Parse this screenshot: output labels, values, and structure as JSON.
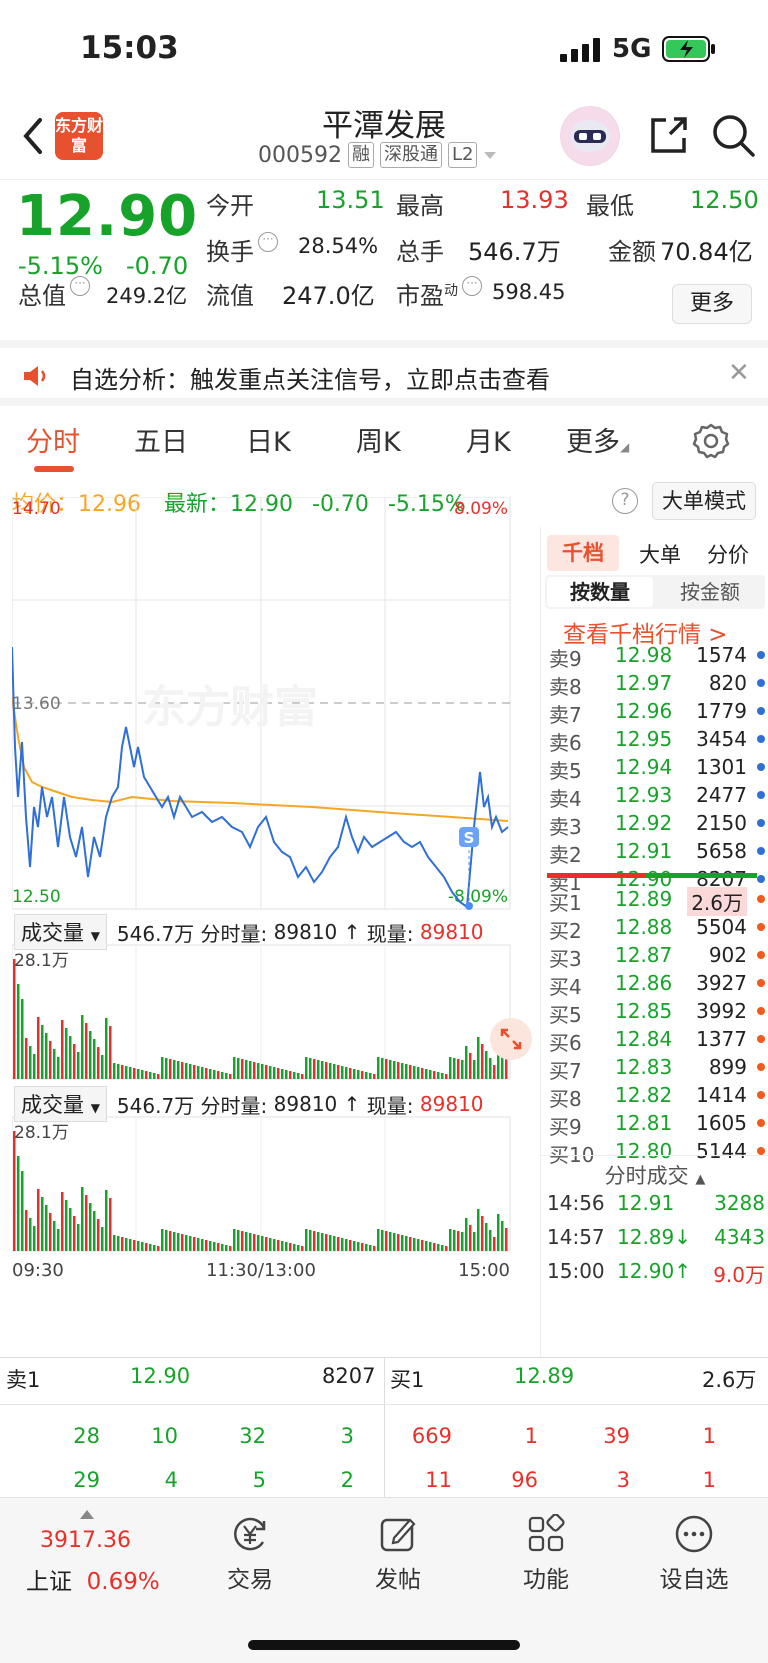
{
  "status_bar": {
    "time": "15:03",
    "network": "5G"
  },
  "header": {
    "logo_text": "东方财富",
    "stock_name": "平潭发展",
    "stock_code": "000592",
    "tags": [
      "融",
      "深股通",
      "L2"
    ]
  },
  "quote": {
    "price": "12.90",
    "change_pct": "-5.15%",
    "change": "-0.70",
    "open_label": "今开",
    "open": "13.51",
    "high_label": "最高",
    "high": "13.93",
    "low_label": "最低",
    "low": "12.50",
    "turnover_label": "换手",
    "turnover": "28.54%",
    "volume_label": "总手",
    "volume": "546.7万",
    "amount_label": "金额",
    "amount": "70.84亿",
    "total_cap_label": "总值",
    "total_cap": "249.2亿",
    "float_cap_label": "流值",
    "float_cap": "247.0亿",
    "pe_label": "市盈",
    "pe_sup": "动",
    "pe": "598.45",
    "more_button": "更多"
  },
  "banner": {
    "text": "自选分析：触发重点关注信号，立即点击查看"
  },
  "tabs": [
    "分时",
    "五日",
    "日K",
    "周K",
    "月K",
    "更多"
  ],
  "summary": {
    "avg_label": "均价：",
    "avg": "12.96",
    "latest_label": "最新：",
    "latest": "12.90",
    "latest_chg": "-0.70",
    "latest_pct": "-5.15%",
    "big_order_button": "大单模式"
  },
  "chart": {
    "y_top": "14.70",
    "y_mid": "13.60",
    "y_bottom": "12.50",
    "pct_top": "8.09%",
    "pct_bottom": "-8.09%",
    "watermark": "东方财富",
    "marker": "S",
    "x_labels": [
      "09:30",
      "11:30/13:00",
      "15:00"
    ]
  },
  "volume_panels": [
    {
      "select": "成交量",
      "total": "546.7万",
      "minute_label": "分时量:",
      "minute": "89810",
      "arrow": "↑",
      "now_label": "现量:",
      "now": "89810",
      "ymax": "28.1万"
    },
    {
      "select": "成交量",
      "total": "546.7万",
      "minute_label": "分时量:",
      "minute": "89810",
      "arrow": "↑",
      "now_label": "现量:",
      "now": "89810",
      "ymax": "28.1万"
    }
  ],
  "order_book": {
    "tabs": [
      "千档",
      "大单",
      "分价"
    ],
    "seg": [
      "按数量",
      "按金额"
    ],
    "link": "查看千档行情 >",
    "asks": [
      {
        "label": "卖9",
        "price": "12.98",
        "vol": "1574"
      },
      {
        "label": "卖8",
        "price": "12.97",
        "vol": "820"
      },
      {
        "label": "卖7",
        "price": "12.96",
        "vol": "1779"
      },
      {
        "label": "卖6",
        "price": "12.95",
        "vol": "3454"
      },
      {
        "label": "卖5",
        "price": "12.94",
        "vol": "1301"
      },
      {
        "label": "卖4",
        "price": "12.93",
        "vol": "2477"
      },
      {
        "label": "卖3",
        "price": "12.92",
        "vol": "2150"
      },
      {
        "label": "卖2",
        "price": "12.91",
        "vol": "5658"
      },
      {
        "label": "卖1",
        "price": "12.90",
        "vol": "8207"
      }
    ],
    "bids": [
      {
        "label": "买1",
        "price": "12.89",
        "vol": "2.6万"
      },
      {
        "label": "买2",
        "price": "12.88",
        "vol": "5504"
      },
      {
        "label": "买3",
        "price": "12.87",
        "vol": "902"
      },
      {
        "label": "买4",
        "price": "12.86",
        "vol": "3927"
      },
      {
        "label": "买5",
        "price": "12.85",
        "vol": "3992"
      },
      {
        "label": "买6",
        "price": "12.84",
        "vol": "1377"
      },
      {
        "label": "买7",
        "price": "12.83",
        "vol": "899"
      },
      {
        "label": "买8",
        "price": "12.82",
        "vol": "1414"
      },
      {
        "label": "买9",
        "price": "12.81",
        "vol": "1605"
      },
      {
        "label": "买10",
        "price": "12.80",
        "vol": "5144"
      }
    ],
    "ticks_title": "分时成交",
    "ticks": [
      {
        "time": "14:56",
        "price": "12.91",
        "vol": "3288",
        "pcolor": "#17a32a",
        "vcolor": "#17a32a"
      },
      {
        "time": "14:57",
        "price": "12.89↓",
        "vol": "4343",
        "pcolor": "#17a32a",
        "vcolor": "#17a32a"
      },
      {
        "time": "15:00",
        "price": "12.90↑",
        "vol": "9.0万",
        "pcolor": "#17a32a",
        "vcolor": "#e8302b"
      }
    ]
  },
  "queues": {
    "sell_label": "卖1",
    "sell_price": "12.90",
    "sell_vol": "8207",
    "buy_label": "买1",
    "buy_price": "12.89",
    "buy_vol": "2.6万",
    "sell_rows": [
      [
        "28",
        "10",
        "32",
        "3"
      ],
      [
        "29",
        "4",
        "5",
        "2"
      ]
    ],
    "buy_rows": [
      [
        "669",
        "1",
        "39",
        "1"
      ],
      [
        "11",
        "96",
        "3",
        "1"
      ]
    ]
  },
  "bottom_nav": {
    "index_value": "3917.36",
    "index_name": "上证",
    "index_pct": "0.69%",
    "items": [
      "交易",
      "发帖",
      "功能",
      "设自选"
    ]
  },
  "colors": {
    "up": "#e8302b",
    "down": "#17a32a",
    "accent": "#e8502e",
    "price_line": "#2f6fd6",
    "avg_line": "#f5a623"
  }
}
